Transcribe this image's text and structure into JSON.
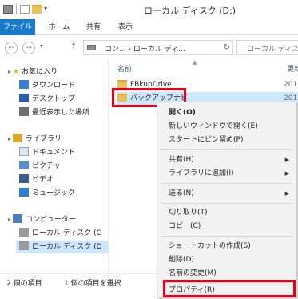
{
  "window": {
    "title": "ローカル ディスク (D:)"
  },
  "ribbon": {
    "tabs": [
      "ファイル",
      "ホーム",
      "共有",
      "表示"
    ]
  },
  "address": {
    "path": "コン... › ローカル ディ...",
    "search_placeholder": "ローカル ディスク"
  },
  "nav_pane": {
    "favorites_label": "お気に入り",
    "favorites": [
      "ダウンロード",
      "デスクトップ",
      "最近表示した場所"
    ],
    "libraries_label": "ライブラリ",
    "libraries": [
      "ドキュメント",
      "ピクチャ",
      "ビデオ",
      "ミュージック"
    ],
    "computer_label": "コンピューター",
    "drives": [
      "ローカル ディスク (C",
      "ローカル ディスク (D"
    ]
  },
  "content": {
    "column_name": "名前",
    "column_date": "更新",
    "files": [
      {
        "name": "FBkupDrive",
        "date": "201"
      },
      {
        "name": "バックアップナビ",
        "date": "201"
      }
    ]
  },
  "context_menu": {
    "items": [
      {
        "label": "開く(O)",
        "bold": true
      },
      {
        "label": "新しいウィンドウで開く(E)"
      },
      {
        "label": "スタートにピン留め(P)"
      },
      {
        "label": "共有(H)",
        "submenu": true
      },
      {
        "label": "ライブラリに追加(I)",
        "submenu": true
      },
      {
        "label": "送る(N)",
        "submenu": true
      },
      {
        "label": "切り取り(T)"
      },
      {
        "label": "コピー(C)"
      },
      {
        "label": "ショートカットの作成(S)"
      },
      {
        "label": "削除(D)"
      },
      {
        "label": "名前の変更(M)"
      },
      {
        "label": "プロパティ(R)"
      }
    ]
  },
  "status": {
    "count": "2 個の項目",
    "selected": "1 個の項目を選択"
  },
  "colors": {
    "accent": "#1979ca",
    "highlight_box": "#e8001b",
    "selection": "#cce8ff"
  }
}
